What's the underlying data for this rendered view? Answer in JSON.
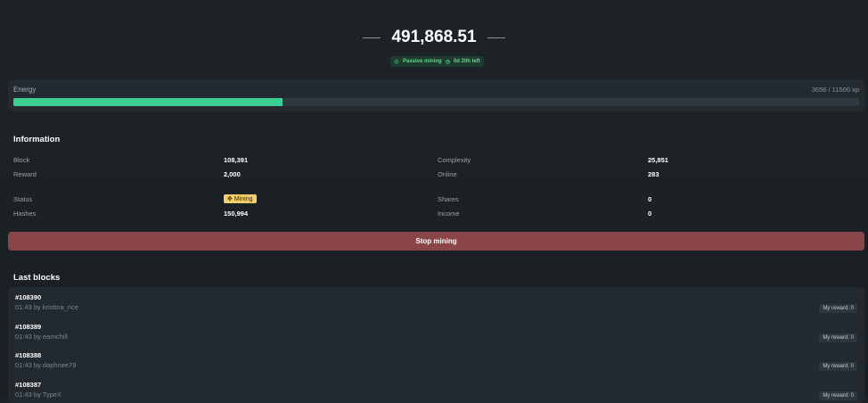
{
  "balance": "491,868.51",
  "badge": {
    "mode": "Passive mining",
    "time": "0d 20h left"
  },
  "energy": {
    "label": "Energy",
    "current": 3656,
    "max": 11500,
    "text": "3656 / 11500 xp",
    "fraction": 0.318
  },
  "info": {
    "title": "Information",
    "block_label": "Block",
    "block": "108,391",
    "reward_label": "Reward",
    "reward": "2,000",
    "complexity_label": "Complexity",
    "complexity": "25,851",
    "online_label": "Online",
    "online": "283",
    "status_label": "Status",
    "status": "Mining",
    "hashes_label": "Hashes",
    "hashes": "150,994",
    "shares_label": "Shares",
    "shares": "0",
    "income_label": "Income",
    "income": "0"
  },
  "stop_label": "Stop mining",
  "last_blocks": {
    "title": "Last blocks",
    "items": [
      {
        "id": "#108390",
        "meta": "01:43 by kristina_rice",
        "reward": "My reward: 0"
      },
      {
        "id": "#108389",
        "meta": "01:43 by earnchill",
        "reward": "My reward: 0"
      },
      {
        "id": "#108388",
        "meta": "01:43 by daphnee79",
        "reward": "My reward: 0"
      },
      {
        "id": "#108387",
        "meta": "01:43 by TypeX",
        "reward": "My reward: 0"
      }
    ]
  },
  "colors": {
    "accent": "#3ccf94",
    "stop": "#8a4548",
    "status": "#f2cd6b"
  }
}
